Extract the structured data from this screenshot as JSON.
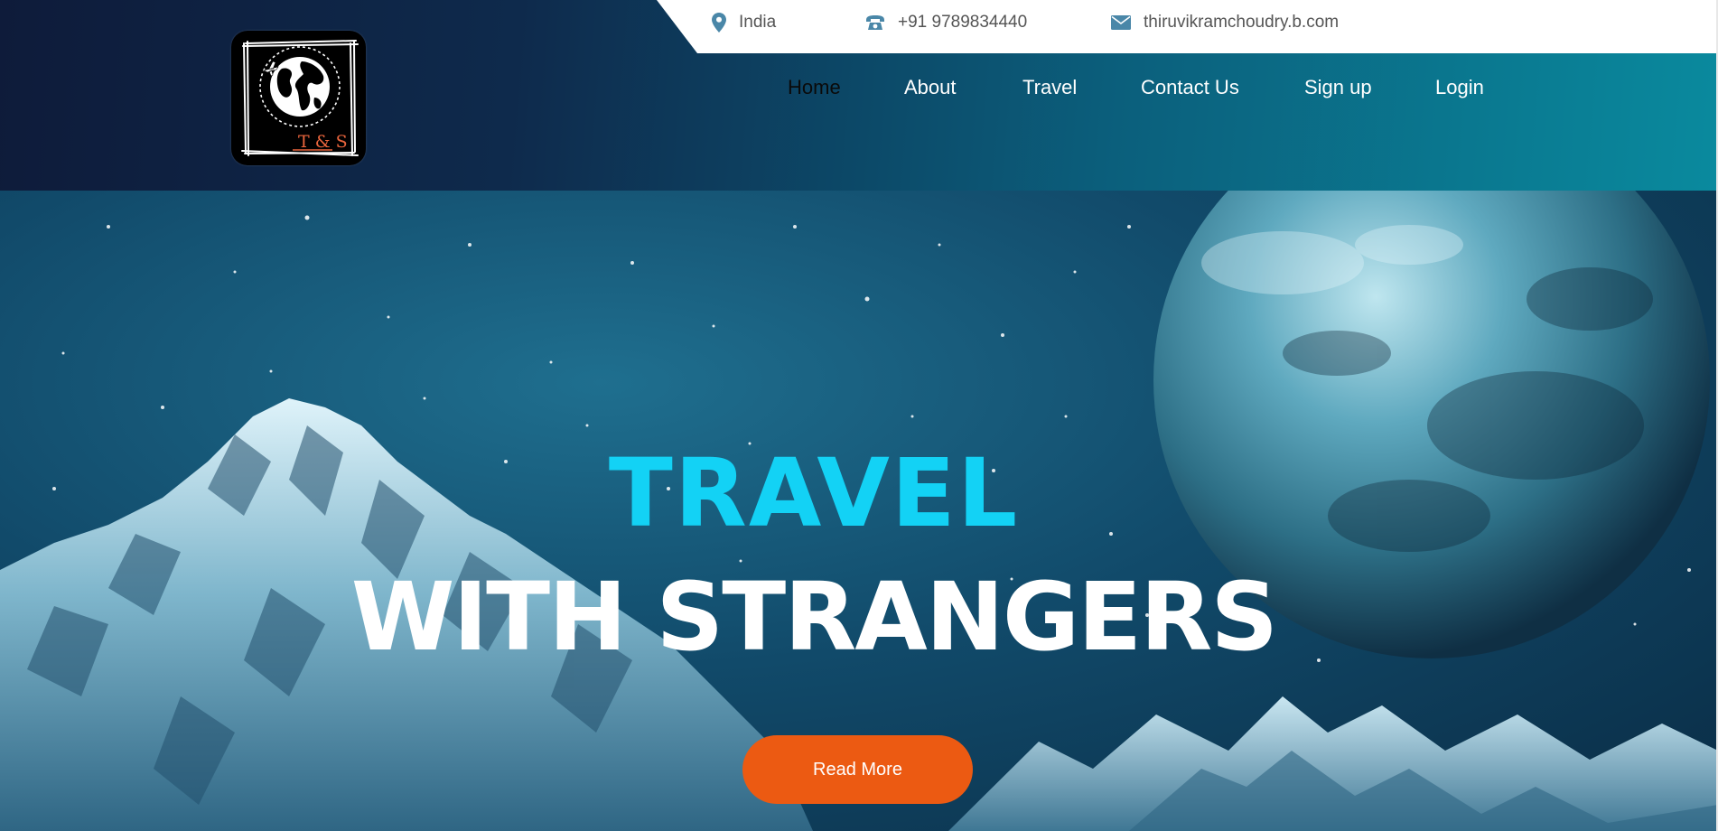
{
  "topbar": {
    "location": "India",
    "phone": "+91 9789834440",
    "email": "thiruvikramchoudry.b.com"
  },
  "logo": {
    "text": "T & S"
  },
  "nav": {
    "items": [
      {
        "label": "Home",
        "active": true
      },
      {
        "label": "About",
        "active": false
      },
      {
        "label": "Travel",
        "active": false
      },
      {
        "label": "Contact Us",
        "active": false
      },
      {
        "label": "Sign up",
        "active": false
      },
      {
        "label": "Login",
        "active": false
      }
    ]
  },
  "hero": {
    "title_line1": "TRAVEL",
    "title_line2": "WITH STRANGERS",
    "cta_label": "Read More"
  },
  "colors": {
    "accent_cyan": "#13d2f5",
    "cta_orange": "#ec5a12",
    "header_dark": "#0e1b3a",
    "header_teal": "#0a8a9e"
  },
  "icons": {
    "location": "map-pin-icon",
    "phone": "phone-icon",
    "email": "envelope-icon"
  }
}
